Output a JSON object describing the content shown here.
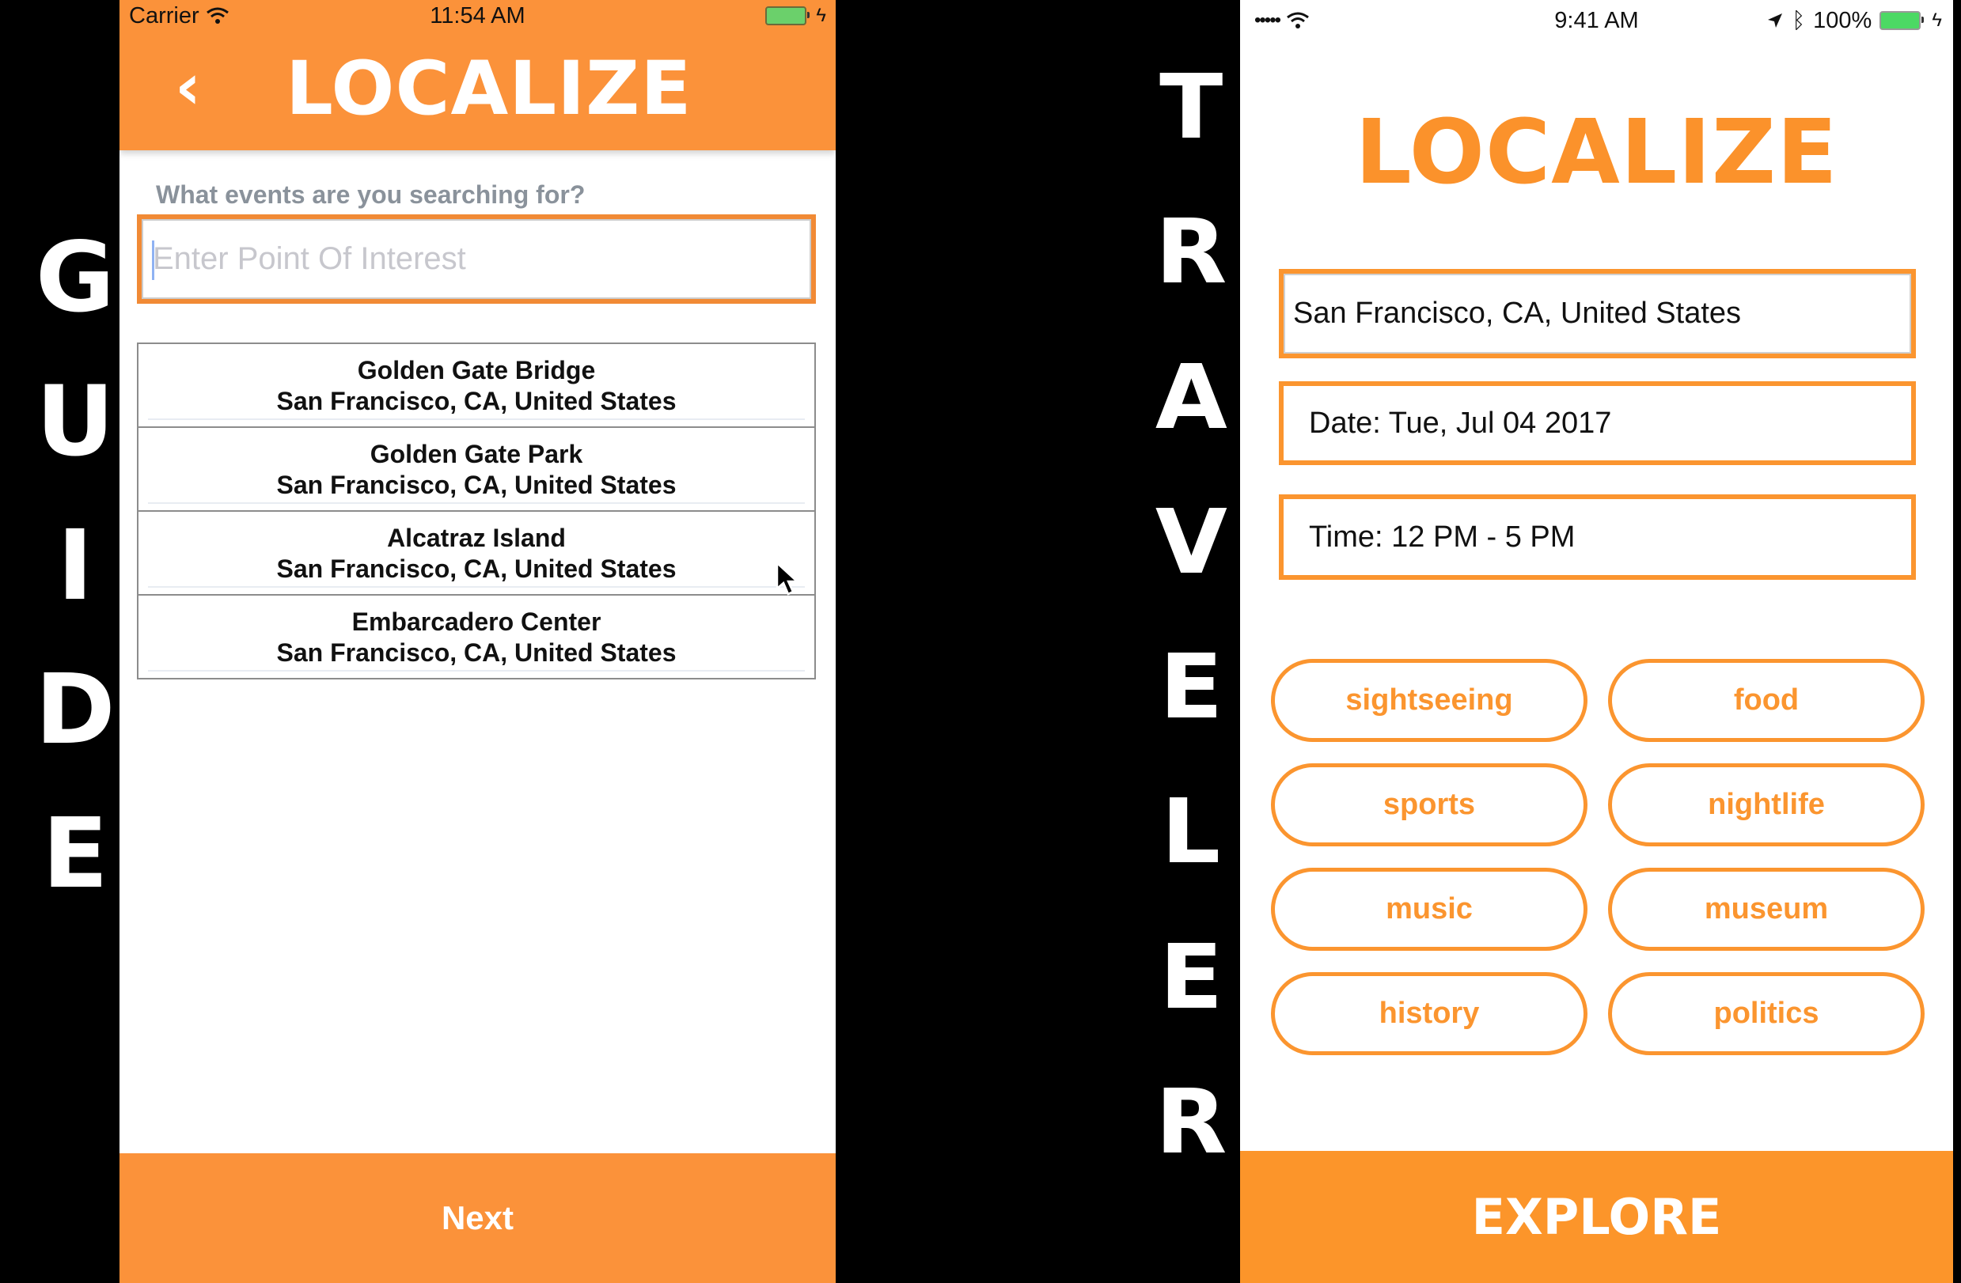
{
  "labels": {
    "guide_letters": [
      "G",
      "U",
      "I",
      "D",
      "E"
    ],
    "traveler_letters": [
      "T",
      "R",
      "A",
      "V",
      "E",
      "L",
      "E",
      "R"
    ]
  },
  "guide_screen": {
    "status_bar": {
      "carrier": "Carrier",
      "time": "11:54 AM"
    },
    "header": {
      "back_icon": "chevron-left-icon",
      "title": "LOCALIZE"
    },
    "search": {
      "label": "What events are you searching for?",
      "value": "",
      "placeholder": "Enter Point Of Interest"
    },
    "results": [
      {
        "name": "Golden Gate Bridge",
        "address": "San Francisco, CA, United States"
      },
      {
        "name": "Golden Gate Park",
        "address": "San Francisco, CA, United States"
      },
      {
        "name": "Alcatraz Island",
        "address": "San Francisco, CA, United States"
      },
      {
        "name": "Embarcadero Center",
        "address": "San Francisco, CA, United States"
      }
    ],
    "next_label": "Next"
  },
  "traveler_screen": {
    "status_bar": {
      "signal": "•••••",
      "time": "9:41 AM",
      "battery_percent": "100%"
    },
    "title": "LOCALIZE",
    "location": "San Francisco, CA, United States",
    "date": "Date: Tue, Jul 04 2017",
    "time_range": "Time: 12 PM - 5 PM",
    "categories": [
      "sightseeing",
      "food",
      "sports",
      "nightlife",
      "music",
      "museum",
      "history",
      "politics"
    ],
    "explore_label": "EXPLORE"
  },
  "colors": {
    "accent_orange": "#fb922b",
    "header_orange": "#fb923a",
    "label_gray": "#8a929b",
    "battery_green": "#4cd964"
  }
}
